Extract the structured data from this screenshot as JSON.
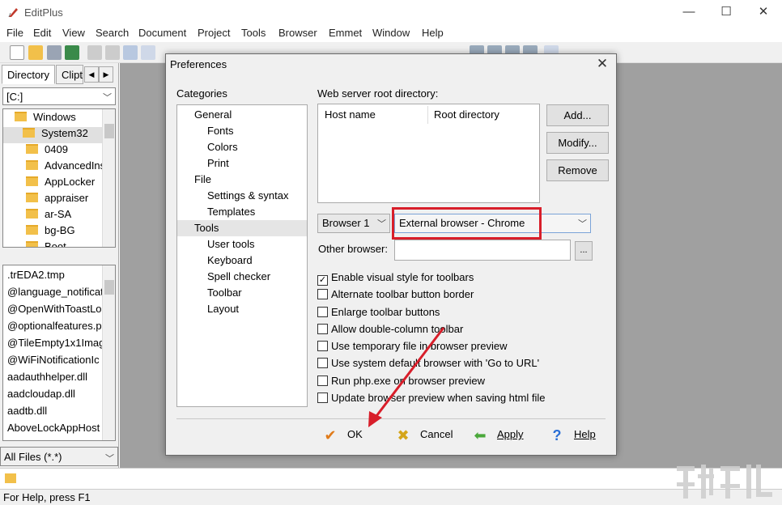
{
  "app": {
    "title": "EditPlus",
    "icon": "editplus-feather-icon"
  },
  "window_controls": {
    "minimize": "—",
    "maximize": "☐",
    "close": "✕"
  },
  "menu": [
    "File",
    "Edit",
    "View",
    "Search",
    "Document",
    "Project",
    "Tools",
    "Browser",
    "Emmet",
    "Window",
    "Help"
  ],
  "left_panel": {
    "tabs": [
      "Directory",
      "Clipt"
    ],
    "drive": "[C:]",
    "folders": [
      "Windows",
      "System32",
      "0409",
      "AdvancedIns",
      "AppLocker",
      "appraiser",
      "ar-SA",
      "bg-BG",
      "Boot"
    ],
    "files": [
      ".trEDA2.tmp",
      "@language_notificat",
      "@OpenWithToastLo",
      "@optionalfeatures.p",
      "@TileEmpty1x1Imag",
      "@WiFiNotificationIc",
      "aadauthhelper.dll",
      "aadcloudap.dll",
      "aadtb.dll",
      "AboveLockAppHost"
    ],
    "filter": "All Files (*.*)"
  },
  "status": "For Help, press F1",
  "dialog": {
    "title": "Preferences",
    "categories_label": "Categories",
    "categories": [
      {
        "label": "General",
        "level": 1
      },
      {
        "label": "Fonts",
        "level": 2
      },
      {
        "label": "Colors",
        "level": 2
      },
      {
        "label": "Print",
        "level": 2
      },
      {
        "label": "File",
        "level": 1
      },
      {
        "label": "Settings & syntax",
        "level": 2
      },
      {
        "label": "Templates",
        "level": 2
      },
      {
        "label": "Tools",
        "level": 1,
        "selected": true
      },
      {
        "label": "User tools",
        "level": 2
      },
      {
        "label": "Keyboard",
        "level": 2
      },
      {
        "label": "Spell checker",
        "level": 2
      },
      {
        "label": "Toolbar",
        "level": 2
      },
      {
        "label": "Layout",
        "level": 2
      }
    ],
    "webserver_label": "Web server root directory:",
    "table_headers": [
      "Host name",
      "Root directory"
    ],
    "buttons": {
      "add": "Add...",
      "modify": "Modify...",
      "remove": "Remove"
    },
    "browser_slot": "Browser 1",
    "browser_value": "External browser - Chrome",
    "other_browser_label": "Other browser:",
    "other_browser_value": "",
    "browse_button": "...",
    "checkboxes": [
      {
        "label": "Enable visual style for toolbars",
        "checked": true
      },
      {
        "label": "Alternate toolbar button border",
        "checked": false
      },
      {
        "label": "Enlarge toolbar buttons",
        "checked": false
      },
      {
        "label": "Allow double-column toolbar",
        "checked": false
      },
      {
        "label": "Use temporary file in browser preview",
        "checked": false
      },
      {
        "label": "Use system default browser with 'Go to URL'",
        "checked": false
      },
      {
        "label": "Run php.exe on browser preview",
        "checked": false
      },
      {
        "label": "Update browser preview when saving html file",
        "checked": false
      }
    ],
    "actions": {
      "ok": "OK",
      "cancel": "Cancel",
      "apply": "Apply",
      "help": "Help"
    }
  },
  "colors": {
    "highlight": "#d81e2a",
    "arrow": "#d81e2a",
    "workspace": "#a0a0a0"
  }
}
